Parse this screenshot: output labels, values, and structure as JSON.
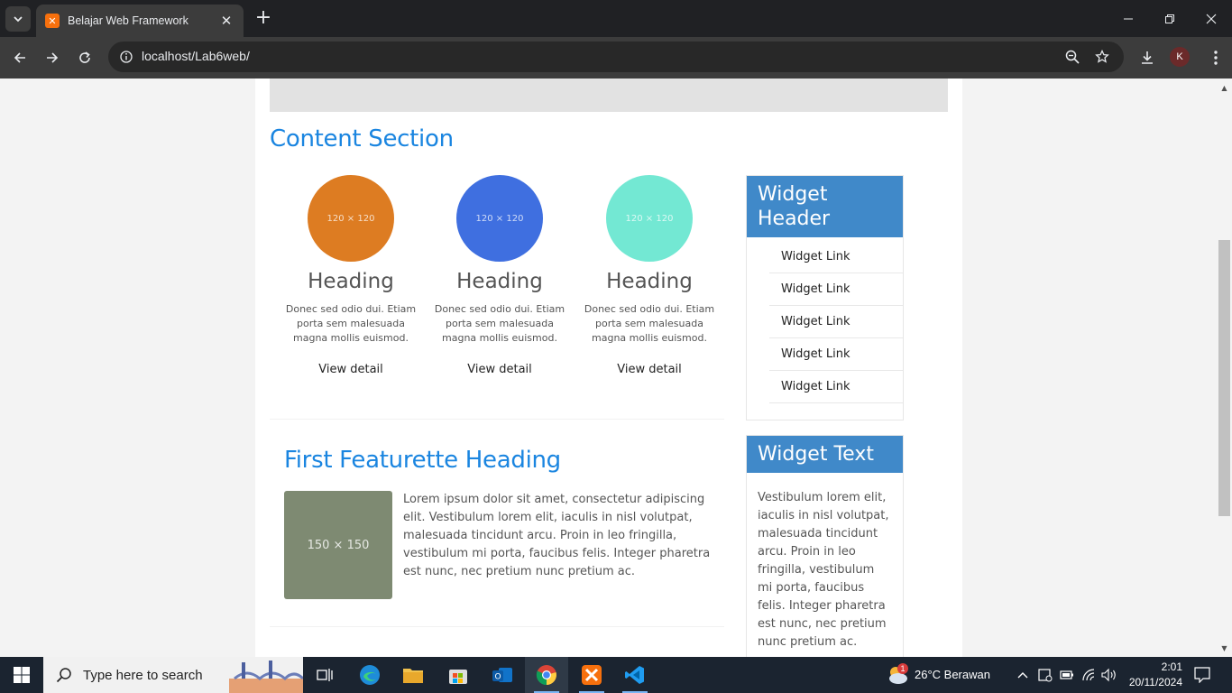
{
  "browser": {
    "tab_title": "Belajar Web Framework",
    "tab_favicon": "xampp-icon",
    "url": "localhost/Lab6web/",
    "profile_initial": "K"
  },
  "page": {
    "section_title": "Content Section",
    "columns": [
      {
        "circle_label": "120 × 120",
        "circle_color": "#dd7c22",
        "heading": "Heading",
        "text": "Donec sed odio dui. Etiam porta sem malesuada magna mollis euismod.",
        "link": "View detail"
      },
      {
        "circle_label": "120 × 120",
        "circle_color": "#3f6fe0",
        "heading": "Heading",
        "text": "Donec sed odio dui. Etiam porta sem malesuada magna mollis euismod.",
        "link": "View detail"
      },
      {
        "circle_label": "120 × 120",
        "circle_color": "#73e8d3",
        "heading": "Heading",
        "text": "Donec sed odio dui. Etiam porta sem malesuada magna mollis euismod.",
        "link": "View detail"
      }
    ],
    "featurette": {
      "heading": "First Featurette Heading",
      "image_label": "150 × 150",
      "image_color": "#7e8a72",
      "text": "Lorem ipsum dolor sit amet, consectetur adipiscing elit. Vestibulum lorem elit, iaculis in nisl volutpat, malesuada tincidunt arcu. Proin in leo fringilla, vestibulum mi porta, faucibus felis. Integer pharetra est nunc, nec pretium nunc pretium ac."
    },
    "widget_links": {
      "header": "Widget Header",
      "links": [
        "Widget Link",
        "Widget Link",
        "Widget Link",
        "Widget Link",
        "Widget Link"
      ]
    },
    "widget_text": {
      "header": "Widget Text",
      "body": "Vestibulum lorem elit, iaculis in nisl volutpat, malesuada tincidunt arcu. Proin in leo fringilla, vestibulum mi porta, faucibus felis. Integer pharetra est nunc, nec pretium nunc pretium ac."
    }
  },
  "taskbar": {
    "search_placeholder": "Type here to search",
    "weather": "26°C  Berawan",
    "notification_badge": "1",
    "time": "2:01",
    "date": "20/11/2024"
  },
  "colors": {
    "accent_blue": "#1a85e0",
    "widget_header": "#4089c9"
  }
}
